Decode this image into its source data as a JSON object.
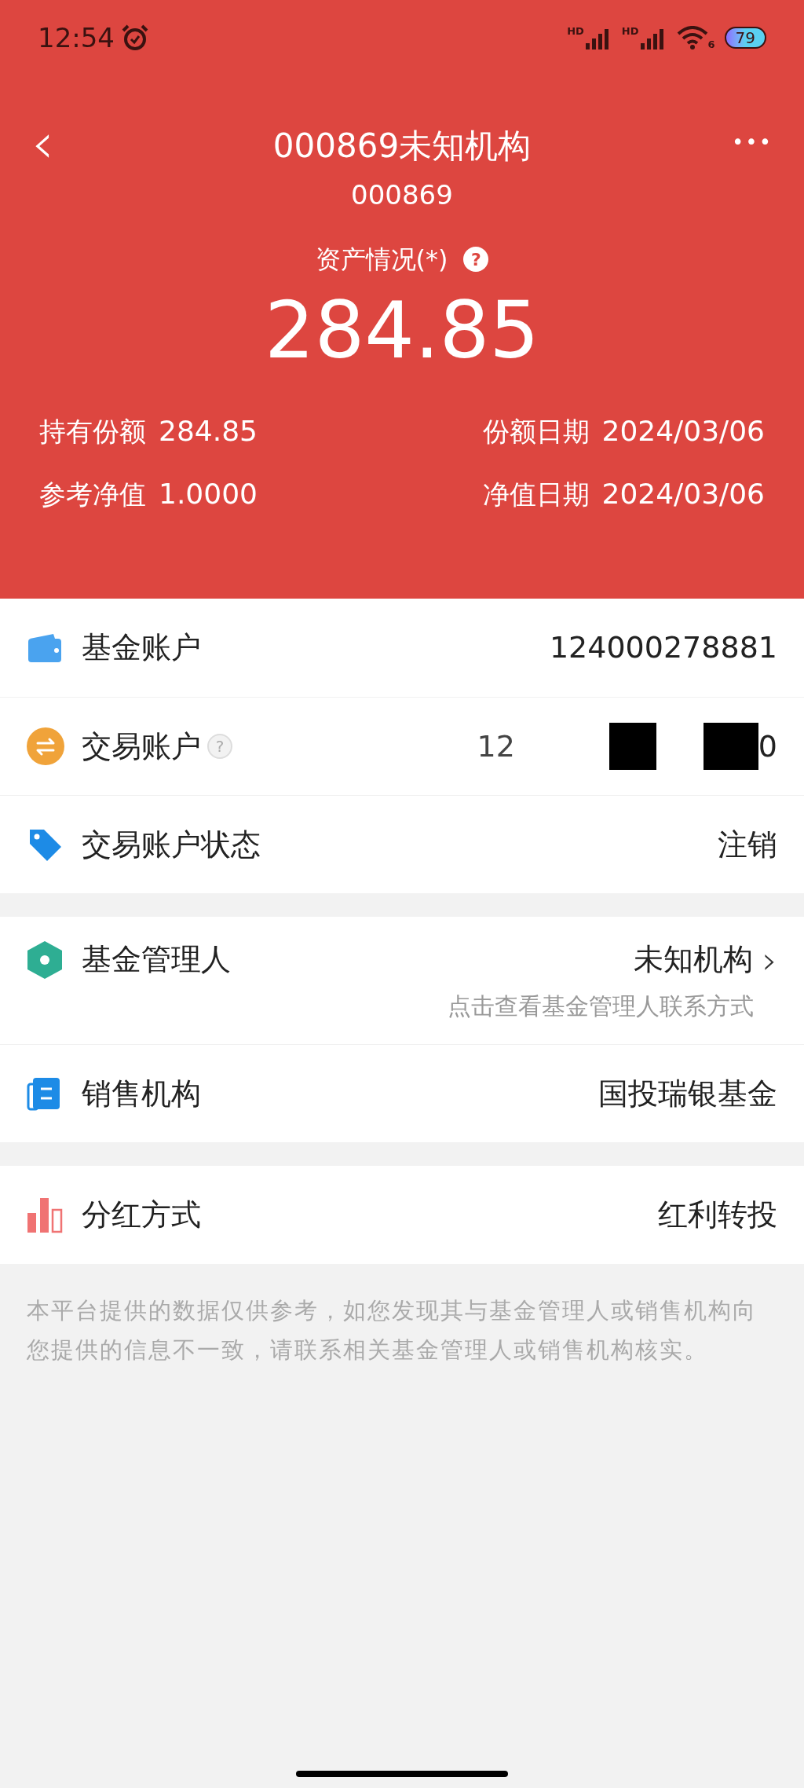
{
  "status_bar": {
    "time": "12:54",
    "sim1": "HD",
    "sim2": "HD",
    "wifi_badge": "6",
    "battery": "79"
  },
  "header": {
    "back": "‹",
    "title": "000869未知机构",
    "code": "000869",
    "more": "•••",
    "asset_label": "资产情况(*)",
    "help": "?",
    "asset_value": "284.85",
    "stats": [
      {
        "label": "持有份额",
        "value": "284.85"
      },
      {
        "label": "份额日期",
        "value": "2024/03/06"
      },
      {
        "label": "参考净值",
        "value": "1.0000"
      },
      {
        "label": "净值日期",
        "value": "2024/03/06"
      }
    ]
  },
  "groups": [
    {
      "rows": [
        {
          "kind": "wallet",
          "label": "基金账户",
          "value": "124000278881"
        },
        {
          "kind": "exchange",
          "label": "交易账户",
          "help": "?",
          "value_start": "12",
          "value_end": "0"
        },
        {
          "kind": "tag",
          "label": "交易账户状态",
          "value": "注销"
        }
      ]
    },
    {
      "rows": [
        {
          "kind": "manager",
          "label": "基金管理人",
          "value": "未知机构",
          "chevron": "›",
          "sub": "点击查看基金管理人联系方式"
        },
        {
          "kind": "seller",
          "label": "销售机构",
          "value": "国投瑞银基金"
        }
      ]
    },
    {
      "rows": [
        {
          "kind": "dividend",
          "label": "分红方式",
          "value": "红利转投"
        }
      ]
    }
  ],
  "disclaimer": "本平台提供的数据仅供参考，如您发现其与基金管理人或销售机构向您提供的信息不一致，请联系相关基金管理人或销售机构核实。"
}
